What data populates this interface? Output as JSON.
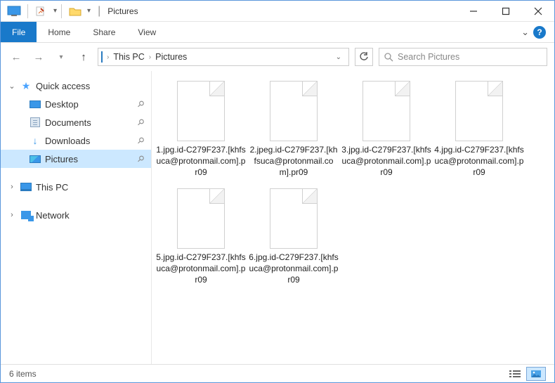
{
  "titlebar": {
    "title": "Pictures"
  },
  "ribbon": {
    "file": "File",
    "tabs": [
      "Home",
      "Share",
      "View"
    ]
  },
  "breadcrumb": {
    "items": [
      "This PC",
      "Pictures"
    ]
  },
  "search": {
    "placeholder": "Search Pictures"
  },
  "sidebar": {
    "quick_access": "Quick access",
    "pinned": [
      {
        "label": "Desktop",
        "icon": "desktop"
      },
      {
        "label": "Documents",
        "icon": "docs"
      },
      {
        "label": "Downloads",
        "icon": "dl"
      },
      {
        "label": "Pictures",
        "icon": "pics",
        "selected": true
      }
    ],
    "this_pc": "This PC",
    "network": "Network"
  },
  "files": [
    {
      "name": "1.jpg.id-C279F237.[khfsuca@protonmail.com].pr09"
    },
    {
      "name": "2.jpeg.id-C279F237.[khfsuca@protonmail.com].pr09"
    },
    {
      "name": "3.jpg.id-C279F237.[khfsuca@protonmail.com].pr09"
    },
    {
      "name": "4.jpg.id-C279F237.[khfsuca@protonmail.com].pr09"
    },
    {
      "name": "5.jpg.id-C279F237.[khfsuca@protonmail.com].pr09"
    },
    {
      "name": "6.jpg.id-C279F237.[khfsuca@protonmail.com].pr09"
    }
  ],
  "statusbar": {
    "count": "6 items"
  }
}
